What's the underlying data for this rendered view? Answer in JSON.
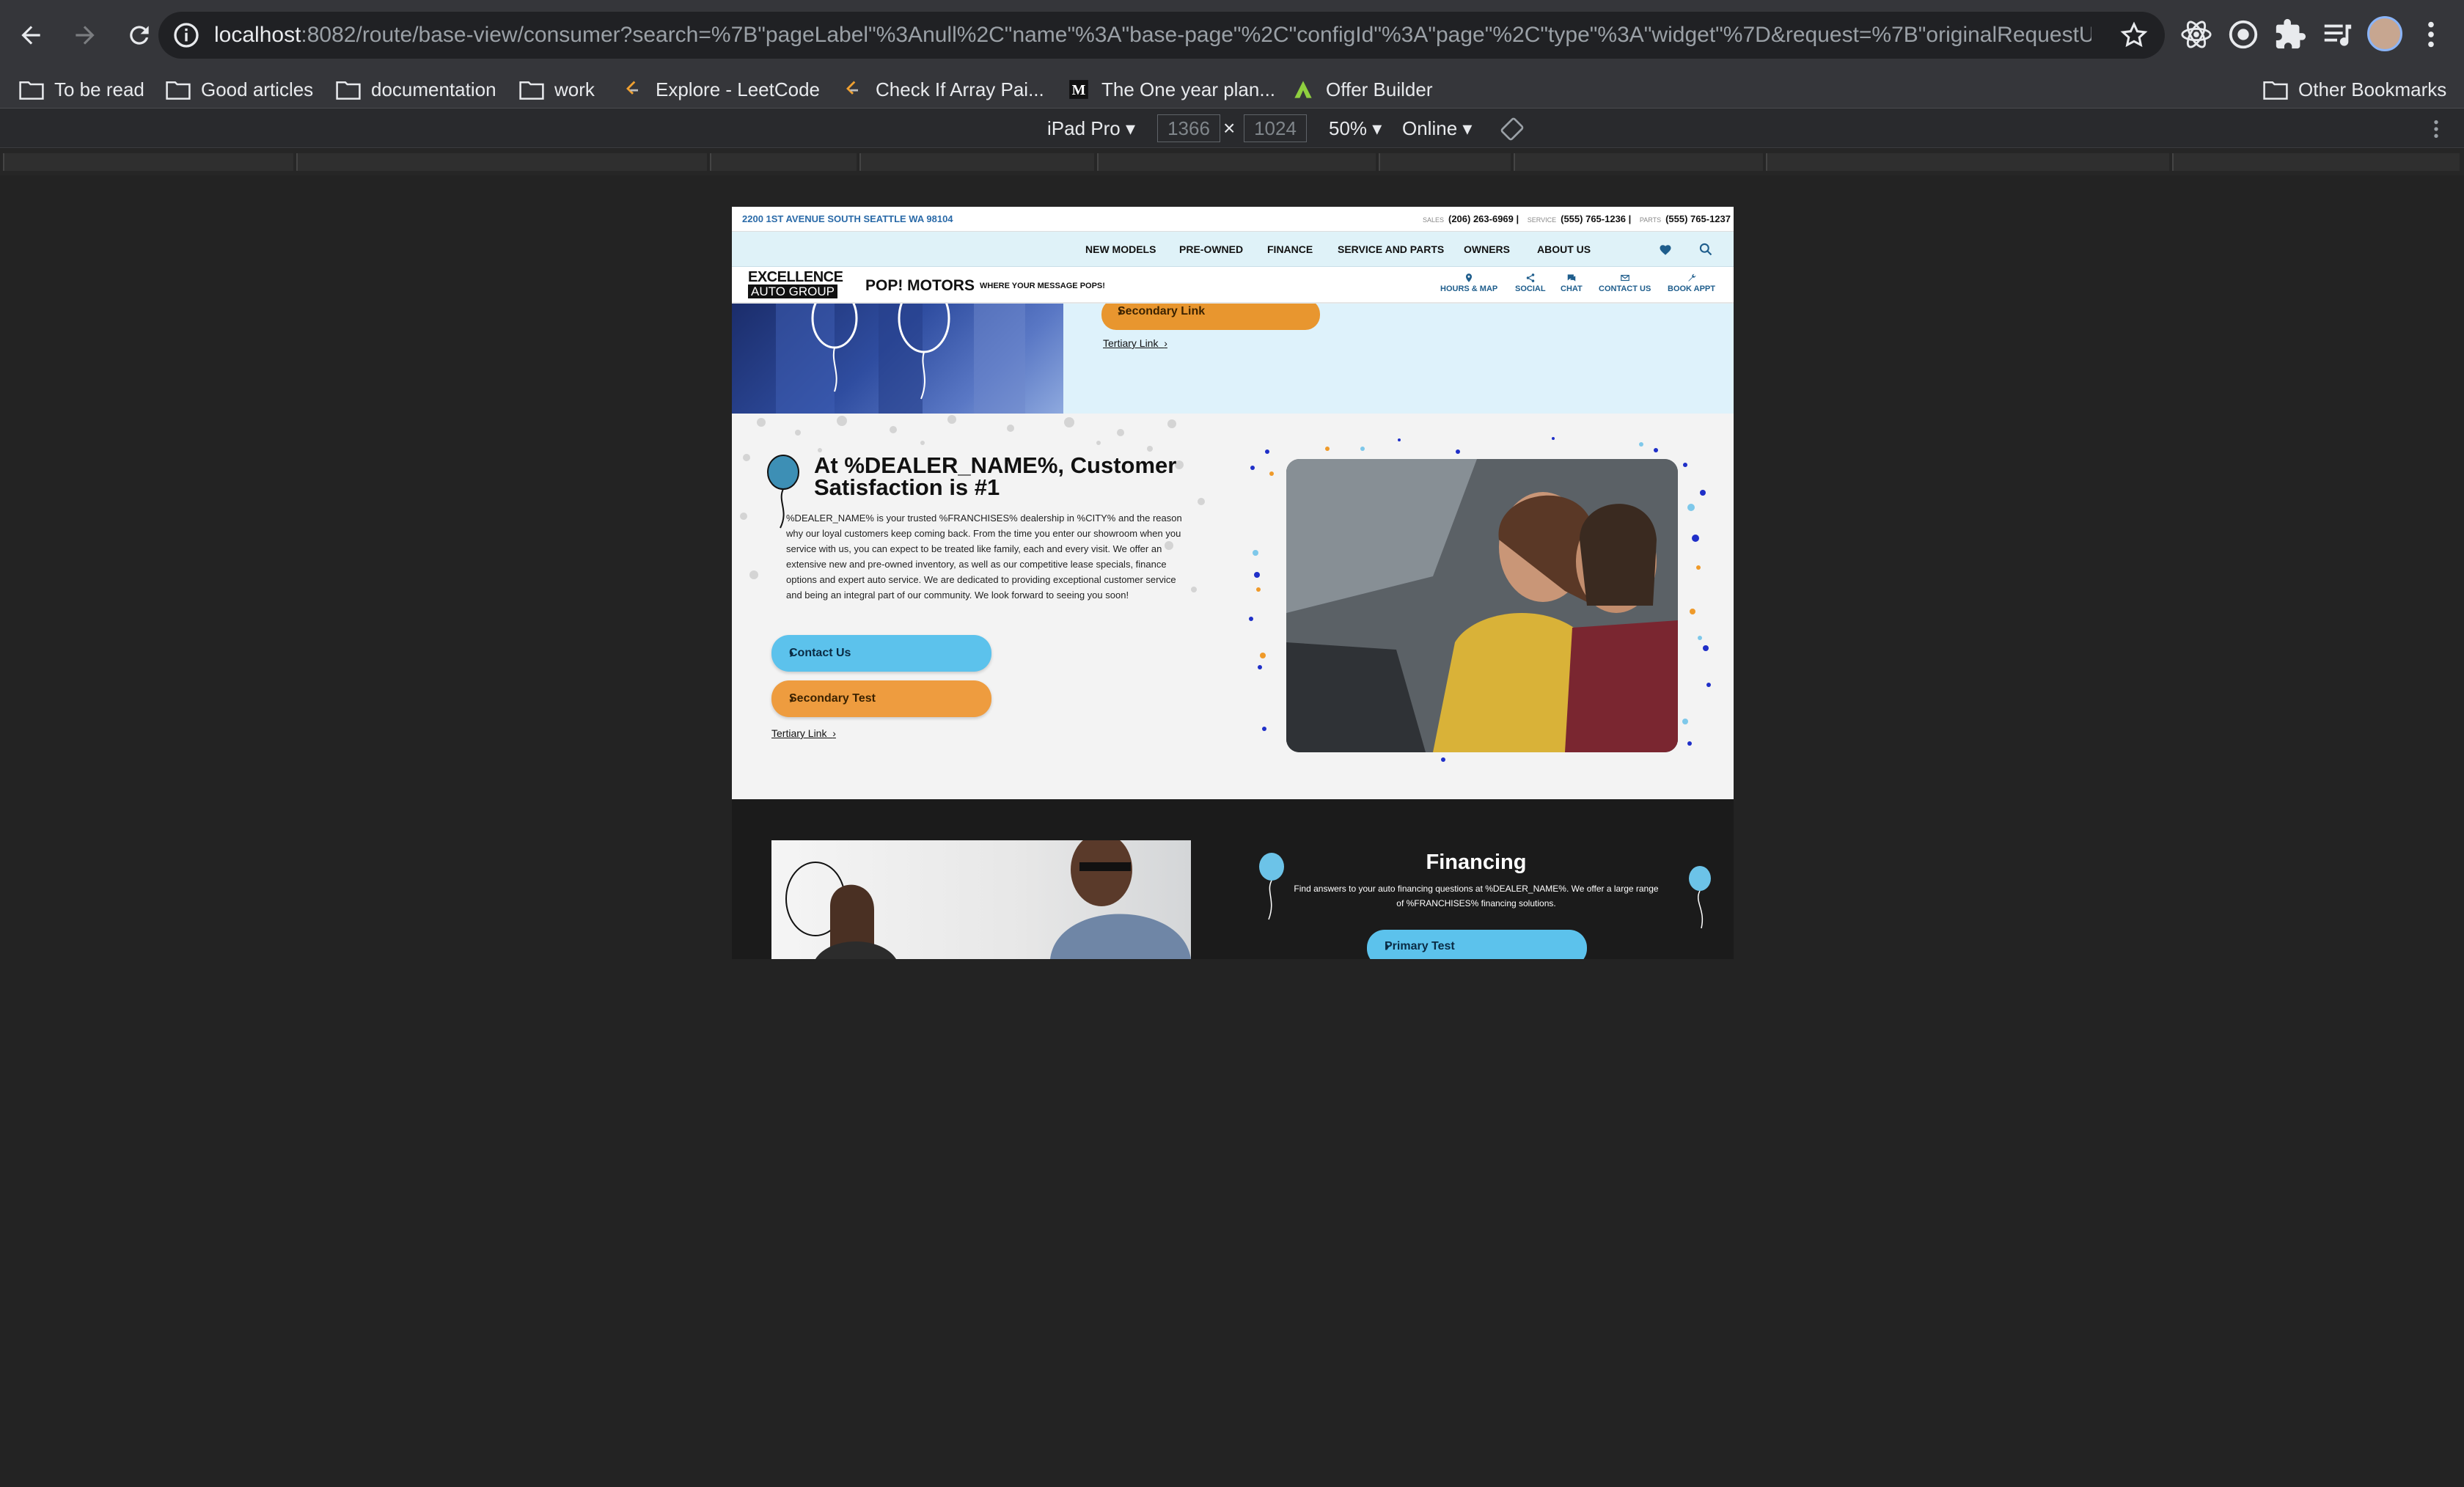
{
  "browser": {
    "url_host": "localhost",
    "url_rest": ":8082/route/base-view/consumer?search=%7B\"pageLabel\"%3Anull%2C\"name\"%3A\"base-page\"%2C\"configId\"%3A\"page\"%2C\"type\"%3A\"widget\"%7D&request=%7B\"originalRequestUri...",
    "bookmarks": [
      {
        "label": "To be read",
        "icon": "folder-icon"
      },
      {
        "label": "Good articles",
        "icon": "folder-icon"
      },
      {
        "label": "documentation",
        "icon": "folder-icon"
      },
      {
        "label": "work",
        "icon": "folder-icon"
      },
      {
        "label": "Explore - LeetCode",
        "icon": "leetcode-icon"
      },
      {
        "label": "Check If Array Pai...",
        "icon": "leetcode-icon"
      },
      {
        "label": "The One year plan...",
        "icon": "medium-icon"
      },
      {
        "label": "Offer Builder",
        "icon": "offer-builder-icon"
      }
    ],
    "other_bookmarks": "Other Bookmarks"
  },
  "devtools": {
    "device": "iPad Pro",
    "width": "1366",
    "height": "1024",
    "times": "×",
    "zoom": "50%",
    "network": "Online"
  },
  "site": {
    "address": "2200 1ST AVENUE SOUTH SEATTLE WA 98104",
    "phones": [
      {
        "label": "SALES",
        "number": "(206) 263-6969"
      },
      {
        "label": "SERVICE",
        "number": "(555) 765-1236"
      },
      {
        "label": "PARTS",
        "number": "(555) 765-1237"
      }
    ],
    "nav": [
      "NEW MODELS",
      "PRE-OWNED",
      "FINANCE",
      "SERVICE AND PARTS",
      "OWNERS",
      "ABOUT US"
    ],
    "logo_line1": "EXCELLENCE",
    "logo_line2": "AUTO GROUP",
    "brand": "POP! MOTORS",
    "tagline": "WHERE YOUR MESSAGE POPS!",
    "utilities": [
      "HOURS & MAP",
      "SOCIAL",
      "CHAT",
      "CONTACT US",
      "BOOK APPT"
    ],
    "hero": {
      "secondary_link": "Secondary Link",
      "tertiary_link": "Tertiary Link"
    },
    "satisfaction": {
      "title": "At %DEALER_NAME%, Customer Satisfaction is #1",
      "body": "%DEALER_NAME% is your trusted %FRANCHISES% dealership in %CITY% and the reason why our loyal customers keep coming back. From the time you enter our showroom when you service with us, you can expect to be treated like family, each and every visit. We offer an extensive new and pre-owned inventory, as well as our competitive lease specials, finance options and expert auto service. We are dedicated to providing exceptional customer service and being an integral part of our community. We look forward to seeing you soon!",
      "primary": "Contact Us",
      "secondary": "Secondary Test",
      "tertiary": "Tertiary Link"
    },
    "financing": {
      "title": "Financing",
      "body": "Find answers to your auto financing questions at %DEALER_NAME%. We offer a large range of %FRANCHISES% financing solutions.",
      "primary": "Primary Test"
    }
  },
  "colors": {
    "chrome": "#35363a",
    "accent_blue": "#5cc2ec",
    "accent_orange": "#ee9c3f",
    "nav_bg": "#dff2f8"
  }
}
